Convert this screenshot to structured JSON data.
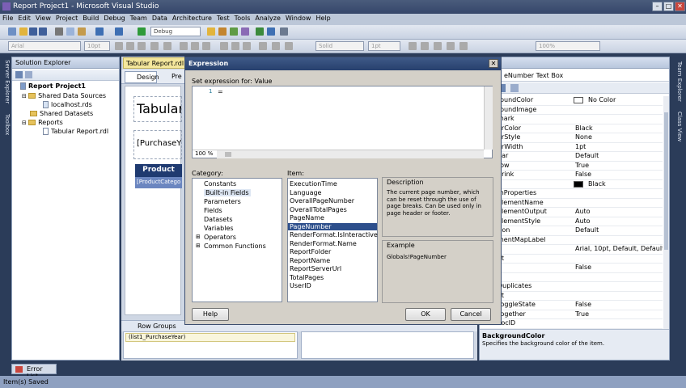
{
  "window": {
    "title": "Report Project1 - Microsoft Visual Studio"
  },
  "menu": [
    "File",
    "Edit",
    "View",
    "Project",
    "Build",
    "Debug",
    "Team",
    "Data",
    "Architecture",
    "Test",
    "Tools",
    "Analyze",
    "Window",
    "Help"
  ],
  "toolbar": {
    "config": "Debug",
    "font": "Arial",
    "font_size": "10pt",
    "border_style": "Solid",
    "border_width": "1pt",
    "zoom": "100%"
  },
  "solution_explorer": {
    "title": "Solution Explorer",
    "items": [
      {
        "label": "Report Project1",
        "icon": "project-icon"
      },
      {
        "label": "Shared Data Sources",
        "icon": "folder-icon"
      },
      {
        "label": "localhost.rds",
        "icon": "datasource-icon"
      },
      {
        "label": "Shared Datasets",
        "icon": "folder-icon"
      },
      {
        "label": "Reports",
        "icon": "folder-icon"
      },
      {
        "label": "Tabular Report.rdl",
        "icon": "report-icon"
      }
    ]
  },
  "side_tabs": {
    "left": [
      "Server Explorer",
      "Toolbox"
    ],
    "right": [
      "Team Explorer",
      "Class View"
    ]
  },
  "document": {
    "tab": "Tabular Report.rdl [De",
    "subtabs": [
      "Design",
      "Pre"
    ],
    "report_title": "Tabular",
    "purchase_field": "[PurchaseY",
    "product_header": "Product",
    "product_cell": "[ProductCatego",
    "row_groups_label": "Row Groups",
    "row_group_item": "(list1_PurchaseYear)"
  },
  "dialog": {
    "title": "Expression",
    "set_expression_label": "Set expression for: Value",
    "line_number": "1",
    "expression": "=",
    "zoom": "100 %",
    "category_label": "Category:",
    "categories": [
      "Constants",
      "Built-in Fields",
      "Parameters",
      "Fields",
      "Datasets",
      "Variables",
      "Operators",
      "Common Functions"
    ],
    "item_label": "Item:",
    "items": [
      "ExecutionTime",
      "Language",
      "OverallPageNumber",
      "OverallTotalPages",
      "PageName",
      "PageNumber",
      "RenderFormat.IsInteractive",
      "RenderFormat.Name",
      "ReportFolder",
      "ReportName",
      "ReportServerUrl",
      "TotalPages",
      "UserID"
    ],
    "selected_item": "PageNumber",
    "description_label": "Description",
    "description": "The current page number, which can be reset through the use of page breaks. Can be used only in page header or footer.",
    "example_label": "Example",
    "example": "Globals!PageNumber",
    "help": "Help",
    "ok": "OK",
    "cancel": "Cancel"
  },
  "properties": {
    "title": "eNumber  Text Box",
    "rows": [
      {
        "n": "roundColor",
        "v": "No Color"
      },
      {
        "n": "roundImage",
        "v": ""
      },
      {
        "n": "mark",
        "v": ""
      },
      {
        "n": "erColor",
        "v": "Black"
      },
      {
        "n": "erStyle",
        "v": "None"
      },
      {
        "n": "erWidth",
        "v": "1pt"
      },
      {
        "n": "dar",
        "v": "Default"
      },
      {
        "n": "row",
        "v": "True"
      },
      {
        "n": "hrink",
        "v": "False"
      },
      {
        "n": "",
        "v": "Black"
      },
      {
        "n": "mProperties",
        "v": ""
      },
      {
        "n": "ElementName",
        "v": ""
      },
      {
        "n": "ElementOutput",
        "v": "Auto"
      },
      {
        "n": "ElementStyle",
        "v": "Auto"
      },
      {
        "n": "tion",
        "v": "Default"
      },
      {
        "n": "mentMapLabel",
        "v": ""
      },
      {
        "n": "",
        "v": "Arial, 10pt, Default, Default, Defa"
      },
      {
        "n": "at",
        "v": ""
      },
      {
        "n": "n",
        "v": "False"
      },
      {
        "n": "",
        "v": ""
      },
      {
        "n": "Duplicates",
        "v": ""
      },
      {
        "n": "at",
        "v": ""
      },
      {
        "n": "ToggleState",
        "v": "False"
      },
      {
        "n": "Together",
        "v": "True"
      },
      {
        "n": "LocID",
        "v": ""
      }
    ],
    "help_title": "BackgroundColor",
    "help_text": "Specifies the background color of the item."
  },
  "bottom": {
    "error_list": "Error List",
    "status": "Item(s) Saved"
  }
}
